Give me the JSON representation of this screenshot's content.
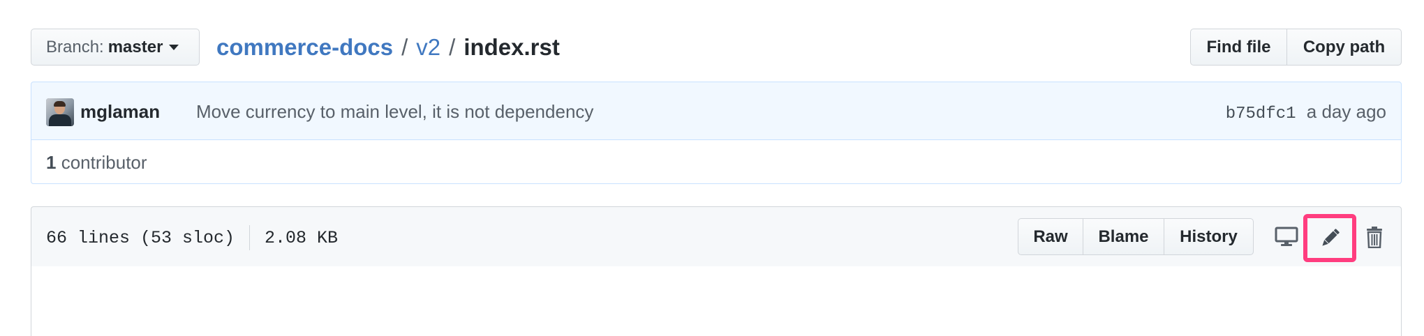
{
  "branch": {
    "prefix": "Branch:",
    "name": "master"
  },
  "breadcrumb": {
    "repo": "commerce-docs",
    "separator": "/",
    "dir": "v2",
    "file": "index.rst"
  },
  "top_actions": {
    "find_file": "Find file",
    "copy_path": "Copy path"
  },
  "commit": {
    "author": "mglaman",
    "message": "Move currency to main level, it is not dependency",
    "sha": "b75dfc1",
    "time": "a day ago"
  },
  "contributors": {
    "count": "1",
    "label": "contributor"
  },
  "file_info": {
    "lines": "66 lines (53 sloc)",
    "size": "2.08 KB"
  },
  "file_actions": {
    "raw": "Raw",
    "blame": "Blame",
    "history": "History"
  },
  "icons": {
    "desktop": "desktop-icon",
    "pencil": "pencil-icon",
    "trash": "trash-icon"
  },
  "colors": {
    "link": "#4078c0",
    "highlight": "#ff3d7f",
    "commit_bg": "#f1f8ff",
    "header_bg": "#f6f8fa"
  }
}
